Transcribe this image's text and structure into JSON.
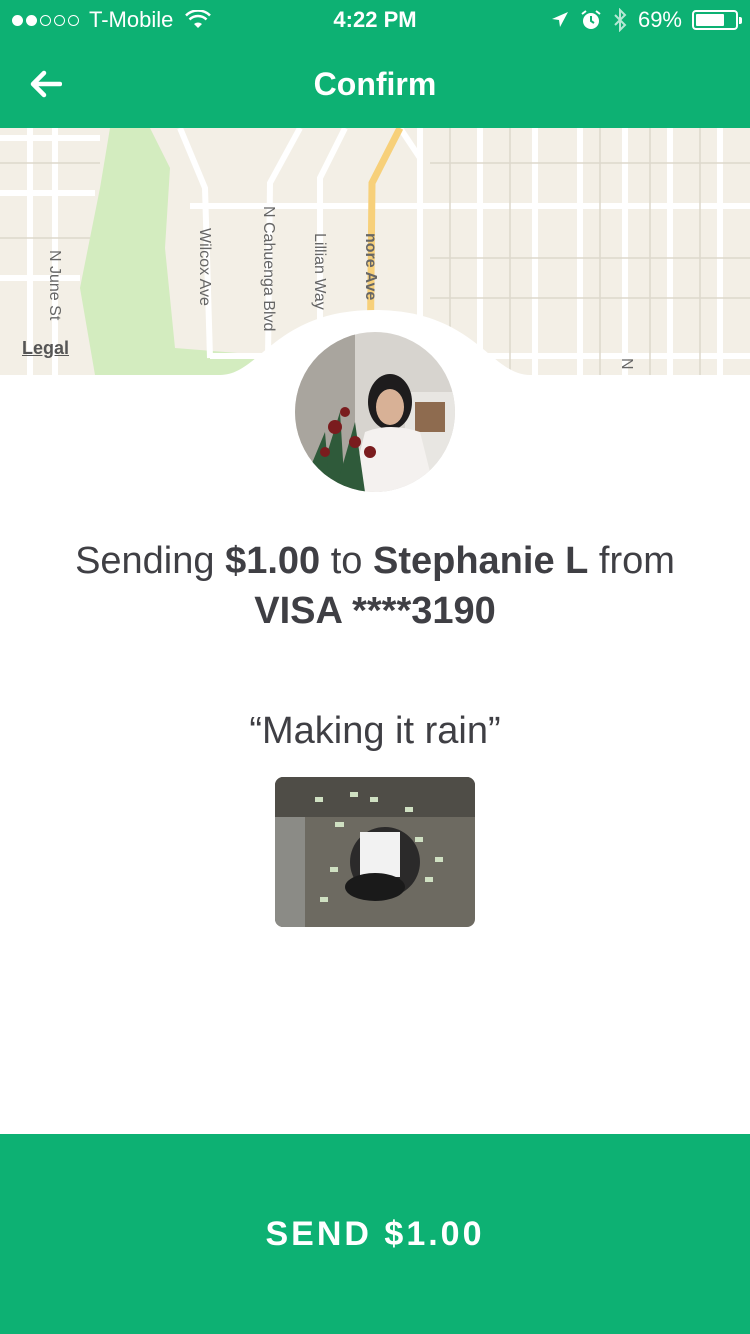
{
  "status_bar": {
    "carrier": "T-Mobile",
    "time": "4:22 PM",
    "battery": "69%",
    "battery_level": 0.69
  },
  "header": {
    "title": "Confirm",
    "back_icon": "arrow-left-icon"
  },
  "map": {
    "legal": "Legal",
    "streets": [
      "N June St",
      "Wilcox Ave",
      "N Cahuenga Blvd",
      "Lillian Way",
      "nore Ave",
      "N"
    ]
  },
  "summary": {
    "prefix": "Sending ",
    "amount": "$1.00",
    "to_word": " to ",
    "recipient": "Stephanie L",
    "from_word": " from",
    "card": "VISA ****3190"
  },
  "note": "“Making it rain”",
  "send_button": "SEND $1.00",
  "colors": {
    "brand": "#0db173",
    "text": "#3f3f44",
    "map_bg": "#f3efe6",
    "park": "#d3ecbf",
    "main_road": "#f7d07a"
  }
}
